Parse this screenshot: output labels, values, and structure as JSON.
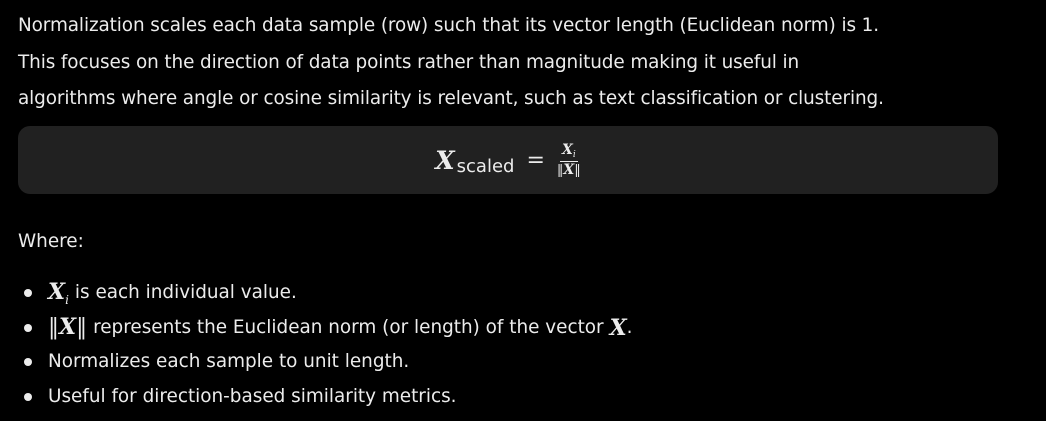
{
  "intro": {
    "line1": "Normalization scales each data sample (row) such that its vector length (Euclidean norm) is 1.",
    "line2": "This focuses on the direction of data points rather than magnitude making it useful in",
    "line3": "algorithms where angle or cosine similarity is relevant, such as text classification or clustering."
  },
  "formula": {
    "lhs_var": "X",
    "lhs_subscript": "scaled",
    "equals": "=",
    "numerator_var": "X",
    "numerator_sub": "i",
    "denominator_left": "‖",
    "denominator_var": "X",
    "denominator_right": "‖"
  },
  "where_label": "Where:",
  "bullets": [
    {
      "math_var": "X",
      "math_sub": "i",
      "text": "is each individual value."
    },
    {
      "math_left": "‖",
      "math_var": "X",
      "math_right": "‖",
      "text": "represents the Euclidean norm (or length) of the vector",
      "trail_var": "X",
      "trail_punct": "."
    },
    {
      "text": "Normalizes each sample to unit length."
    },
    {
      "text": "Useful for direction-based similarity metrics."
    }
  ],
  "colors": {
    "background": "#000000",
    "text": "#ececec",
    "formula_box": "#212121"
  }
}
